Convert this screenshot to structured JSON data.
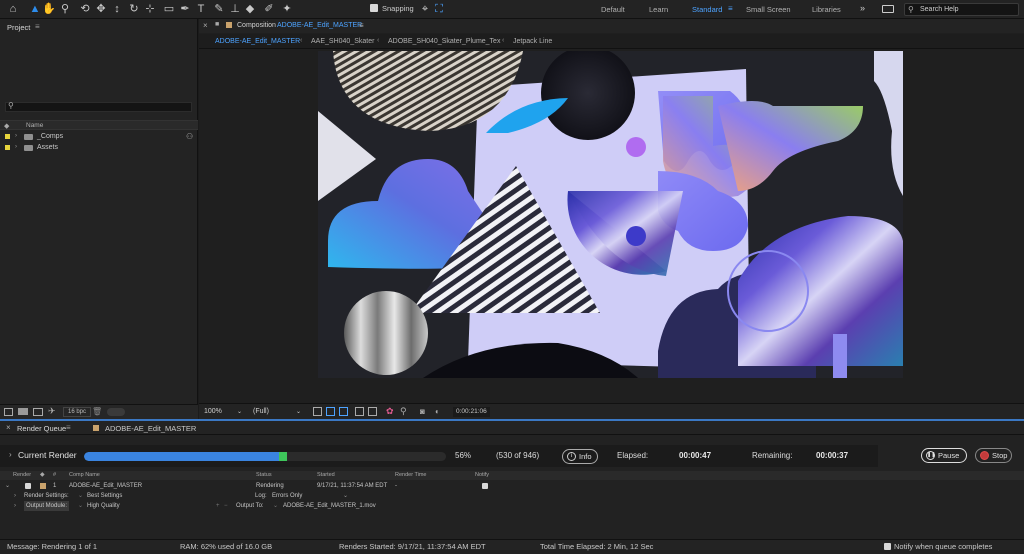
{
  "toolbar": {
    "snapping_label": "Snapping",
    "workspaces": [
      "Default",
      "Learn",
      "Standard",
      "Small Screen",
      "Libraries"
    ],
    "active_workspace": "Standard",
    "search_placeholder": "Search Help"
  },
  "project": {
    "title": "Project",
    "column_name": "Name",
    "items": [
      {
        "label": "_Comps"
      },
      {
        "label": "Assets"
      }
    ],
    "bit_depth": "16 bpc"
  },
  "composition": {
    "tab_prefix": "Composition",
    "tab_name": "ADOBE-AE_Edit_MASTER",
    "subtabs": [
      "ADOBE-AE_Edit_MASTER",
      "AAE_SH040_Skater",
      "ADOBE_SH040_Skater_Plume_Tex",
      "Jetpack Line"
    ],
    "zoom": "100%",
    "resolution": "(Full)",
    "timecode": "0:00:21:06"
  },
  "render_queue": {
    "tab_label": "Render Queue",
    "comp_tab": "ADOBE-AE_Edit_MASTER",
    "current_render_label": "Current Render",
    "progress_fraction": 0.56,
    "percent": "56%",
    "frames": "(530 of 946)",
    "info_label": "Info",
    "elapsed_label": "Elapsed:",
    "elapsed_value": "00:00:47",
    "remaining_label": "Remaining:",
    "remaining_value": "00:00:37",
    "pause_label": "Pause",
    "stop_label": "Stop",
    "columns": {
      "render": "Render",
      "num": "#",
      "comp_name": "Comp Name",
      "status": "Status",
      "started": "Started",
      "render_time": "Render Time",
      "notify": "Notify"
    },
    "item": {
      "num": "1",
      "comp_name": "ADOBE-AE_Edit_MASTER",
      "status": "Rendering",
      "started": "9/17/21, 11:37:54 AM EDT",
      "render_time": "-"
    },
    "render_settings_label": "Render Settings:",
    "render_settings_value": "Best Settings",
    "log_label": "Log:",
    "log_value": "Errors Only",
    "output_module_label": "Output Module:",
    "output_module_value": "High Quality",
    "output_to_label": "Output To:",
    "output_to_value": "ADOBE-AE_Edit_MASTER_1.mov"
  },
  "status": {
    "message": "Message: Rendering 1 of 1",
    "ram": "RAM: 62% used of 16.0 GB",
    "renders_started": "Renders Started: 9/17/21, 11:37:54 AM EDT",
    "total_time": "Total Time Elapsed: 2 Min, 12 Sec",
    "notify_label": "Notify when queue completes"
  },
  "colors": {
    "accent": "#2d8ceb",
    "progress_fill": "#3a84e0",
    "progress_tip": "#3ec65b",
    "label_yellow": "#e7d43c",
    "artboard": "#cfcdf7"
  }
}
